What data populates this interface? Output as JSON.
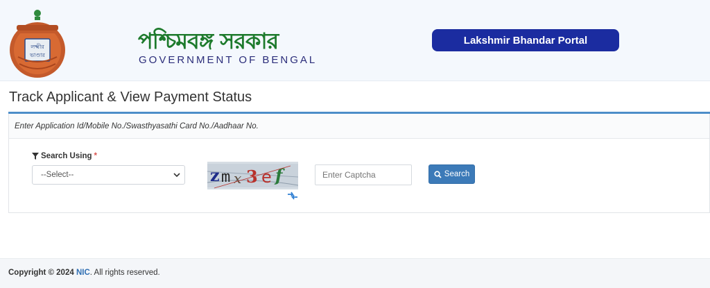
{
  "header": {
    "emblem_text": "লক্ষ্মীর ভাণ্ডার",
    "title_bengali": "পশ্চিমবঙ্গ সরকার",
    "title_english": "GOVERNMENT OF BENGAL",
    "portal_label": "Lakshmir Bhandar Portal",
    "colors": {
      "green": "#1d7a2c",
      "navy": "#1b2ca0"
    }
  },
  "main": {
    "page_title": "Track Applicant & View Payment Status",
    "panel_heading": "Enter Application Id/Mobile No./Swasthyasathi Card No./Aadhaar No.",
    "search_using_label": "Search Using",
    "required_mark": "*",
    "select_value": "--Select--",
    "captcha_text": "zmx3ef",
    "captcha_placeholder": "Enter Captcha",
    "search_label": "Search"
  },
  "footer": {
    "copyright": "Copyright © 2024",
    "org": "NIC",
    "rights": ". All rights reserved."
  },
  "icons": [
    "filter-icon",
    "chevron-down-icon",
    "refresh-icon",
    "search-icon"
  ]
}
